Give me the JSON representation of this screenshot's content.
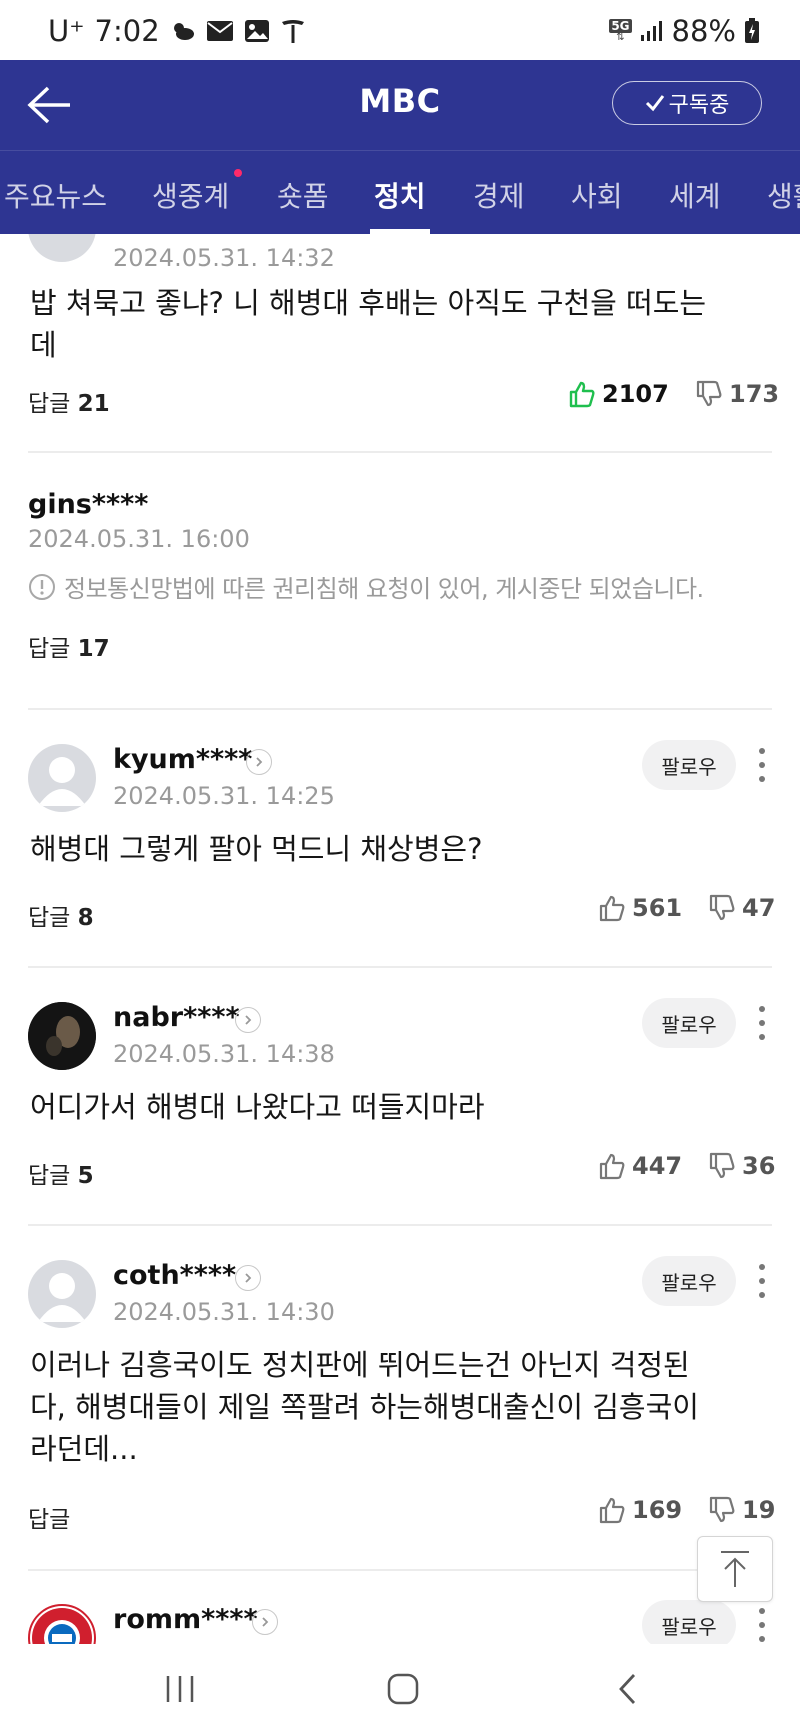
{
  "status_bar": {
    "carrier": "U⁺",
    "time": "7:02",
    "network": "5G",
    "battery": "88%"
  },
  "header": {
    "title": "MBC",
    "subscribe_label": "구독중"
  },
  "tabs": [
    {
      "label": "주요뉴스",
      "active": false
    },
    {
      "label": "생중계",
      "active": false,
      "dot": true
    },
    {
      "label": "숏폼",
      "active": false
    },
    {
      "label": "정치",
      "active": true
    },
    {
      "label": "경제",
      "active": false
    },
    {
      "label": "사회",
      "active": false
    },
    {
      "label": "세계",
      "active": false
    },
    {
      "label": "생활",
      "active": false
    }
  ],
  "comments": [
    {
      "date": "2024.05.31. 14:32",
      "text_lines": [
        "밥 쳐묵고 좋냐? 니 해병대 후배는 아직도 구천을 떠도는",
        "데"
      ],
      "reply_label": "답글",
      "reply_count": "21",
      "likes": "2107",
      "dislikes": "173"
    },
    {
      "username": "gins****",
      "date": "2024.05.31. 16:00",
      "blocked_text": "정보통신망법에 따른 권리침해 요청이 있어, 게시중단 되었습니다.",
      "reply_label": "답글",
      "reply_count": "17"
    },
    {
      "username": "kyum****",
      "date": "2024.05.31. 14:25",
      "text_lines": [
        "해병대 그렇게 팔아 먹드니 채상병은?"
      ],
      "reply_label": "답글",
      "reply_count": "8",
      "likes": "561",
      "dislikes": "47",
      "follow_label": "팔로우"
    },
    {
      "username": "nabr****",
      "date": "2024.05.31. 14:38",
      "text_lines": [
        "어디가서 해병대 나왔다고 떠들지마라"
      ],
      "reply_label": "답글",
      "reply_count": "5",
      "likes": "447",
      "dislikes": "36",
      "follow_label": "팔로우"
    },
    {
      "username": "coth****",
      "date": "2024.05.31. 14:30",
      "text_lines": [
        "이러나 김흥국이도 정치판에 뛰어드는건 아닌지 걱정된",
        "다, 해병대들이 제일 쪽팔려 하는해병대출신이 김흥국이",
        "라던데..."
      ],
      "reply_label": "답글",
      "likes": "169",
      "dislikes": "19",
      "follow_label": "팔로우"
    },
    {
      "username": "romm****",
      "follow_label": "팔로우"
    }
  ],
  "colors": {
    "header_bg": "#2e3592",
    "like_active": "#1fbf4e",
    "tab_dot": "#ff2a6a"
  }
}
